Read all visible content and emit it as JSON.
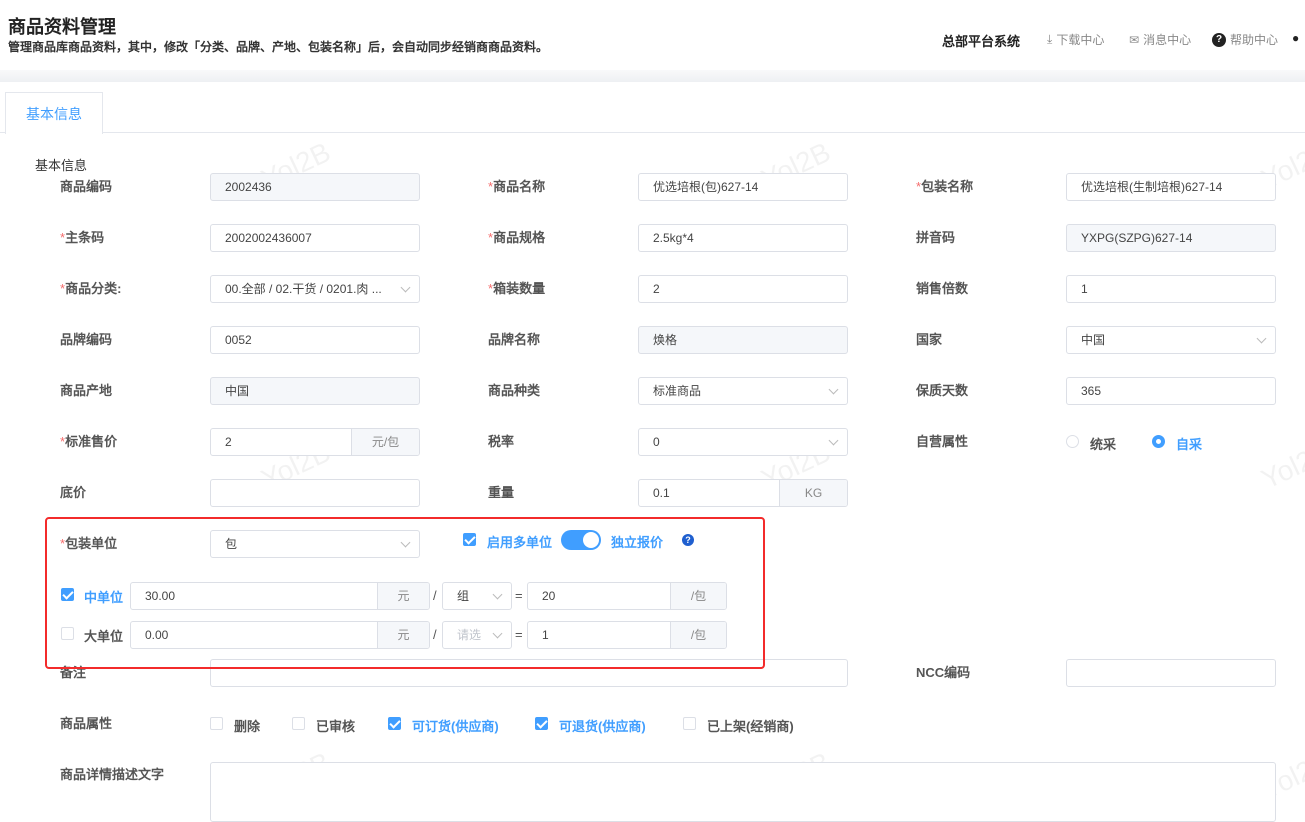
{
  "header": {
    "title": "商品资料管理",
    "subtitle": "管理商品库商品资料，其中，修改「分类、品牌、产地、包装名称」后，会自动同步经销商商品资料。",
    "system": "总部平台系统",
    "download": "下载中心",
    "messages": "消息中心",
    "help": "帮助中心"
  },
  "tab": "基本信息",
  "section": "基本信息",
  "fields": [
    {
      "label": "商品编码",
      "value": "2002436",
      "type": "ro",
      "col": 0,
      "row": 0
    },
    {
      "label": "商品名称",
      "req": true,
      "value": "优选培根(包)627-14",
      "type": "text",
      "col": 1,
      "row": 0
    },
    {
      "label": "包装名称",
      "req": true,
      "value": "优选培根(生制培根)627-14",
      "type": "text",
      "col": 2,
      "row": 0
    },
    {
      "label": "主条码",
      "req": true,
      "value": "2002002436007",
      "type": "text",
      "col": 0,
      "row": 1
    },
    {
      "label": "商品规格",
      "req": true,
      "value": "2.5kg*4",
      "type": "text",
      "col": 1,
      "row": 1
    },
    {
      "label": "拼音码",
      "value": "YXPG(SZPG)627-14",
      "type": "ro",
      "col": 2,
      "row": 1
    },
    {
      "label": "商品分类:",
      "req": true,
      "value": "00.全部 / 02.干货 / 0201.肉  ...",
      "type": "select",
      "col": 0,
      "row": 2
    },
    {
      "label": "箱装数量",
      "req": true,
      "value": "2",
      "type": "text",
      "col": 1,
      "row": 2
    },
    {
      "label": "销售倍数",
      "value": "1",
      "type": "text",
      "col": 2,
      "row": 2
    },
    {
      "label": "品牌编码",
      "value": "0052",
      "type": "text",
      "col": 0,
      "row": 3
    },
    {
      "label": "品牌名称",
      "value": "焕格",
      "type": "ro",
      "col": 1,
      "row": 3
    },
    {
      "label": "国家",
      "value": "中国",
      "type": "select",
      "col": 2,
      "row": 3
    },
    {
      "label": "商品产地",
      "value": "中国",
      "type": "ro",
      "col": 0,
      "row": 4
    },
    {
      "label": "商品种类",
      "value": "标准商品",
      "type": "select",
      "col": 1,
      "row": 4
    },
    {
      "label": "保质天数",
      "value": "365",
      "type": "text",
      "col": 2,
      "row": 4
    },
    {
      "label": "标准售价",
      "req": true,
      "value": "2",
      "type": "suffix",
      "suffix": "元/包",
      "col": 0,
      "row": 5
    },
    {
      "label": "税率",
      "value": "0",
      "type": "select",
      "col": 1,
      "row": 5
    },
    {
      "label": "自营属性",
      "type": "radio",
      "options": [
        "统采",
        "自采"
      ],
      "selected": 1,
      "col": 2,
      "row": 5
    },
    {
      "label": "底价",
      "value": "",
      "type": "text",
      "col": 0,
      "row": 6
    },
    {
      "label": "重量",
      "value": "0.1",
      "type": "suffix",
      "suffix": "KG",
      "col": 1,
      "row": 6
    },
    {
      "label": "包装单位",
      "req": true,
      "value": "包",
      "type": "select",
      "col": 0,
      "row": 7
    }
  ],
  "multi": {
    "enable_label": "启用多单位",
    "enable_checked": true,
    "toggle_on": true,
    "independent_label": "独立报价"
  },
  "units": [
    {
      "label": "中单位",
      "checked": true,
      "price": "30.00",
      "currency": "元",
      "unit": "组",
      "unit_placeholder": false,
      "qty": "20",
      "per": "/包"
    },
    {
      "label": "大单位",
      "checked": false,
      "price": "0.00",
      "currency": "元",
      "unit": "请选",
      "unit_placeholder": true,
      "qty": "1",
      "per": "/包"
    }
  ],
  "remark": {
    "label": "备注",
    "value": ""
  },
  "ncc": {
    "label": "NCC编码",
    "value": ""
  },
  "attrs": {
    "label": "商品属性",
    "items": [
      {
        "label": "删除",
        "checked": false
      },
      {
        "label": "已审核",
        "checked": false
      },
      {
        "label": "可订货(供应商)",
        "checked": true
      },
      {
        "label": "可退货(供应商)",
        "checked": true
      },
      {
        "label": "已上架(经销商)",
        "checked": false
      }
    ]
  },
  "desc": {
    "label": "商品详情描述文字",
    "value": ""
  },
  "watermark": "Yol2B",
  "colors": {
    "accent": "#409eff",
    "required": "#f56c6c",
    "highlight": "#f32b2b"
  }
}
